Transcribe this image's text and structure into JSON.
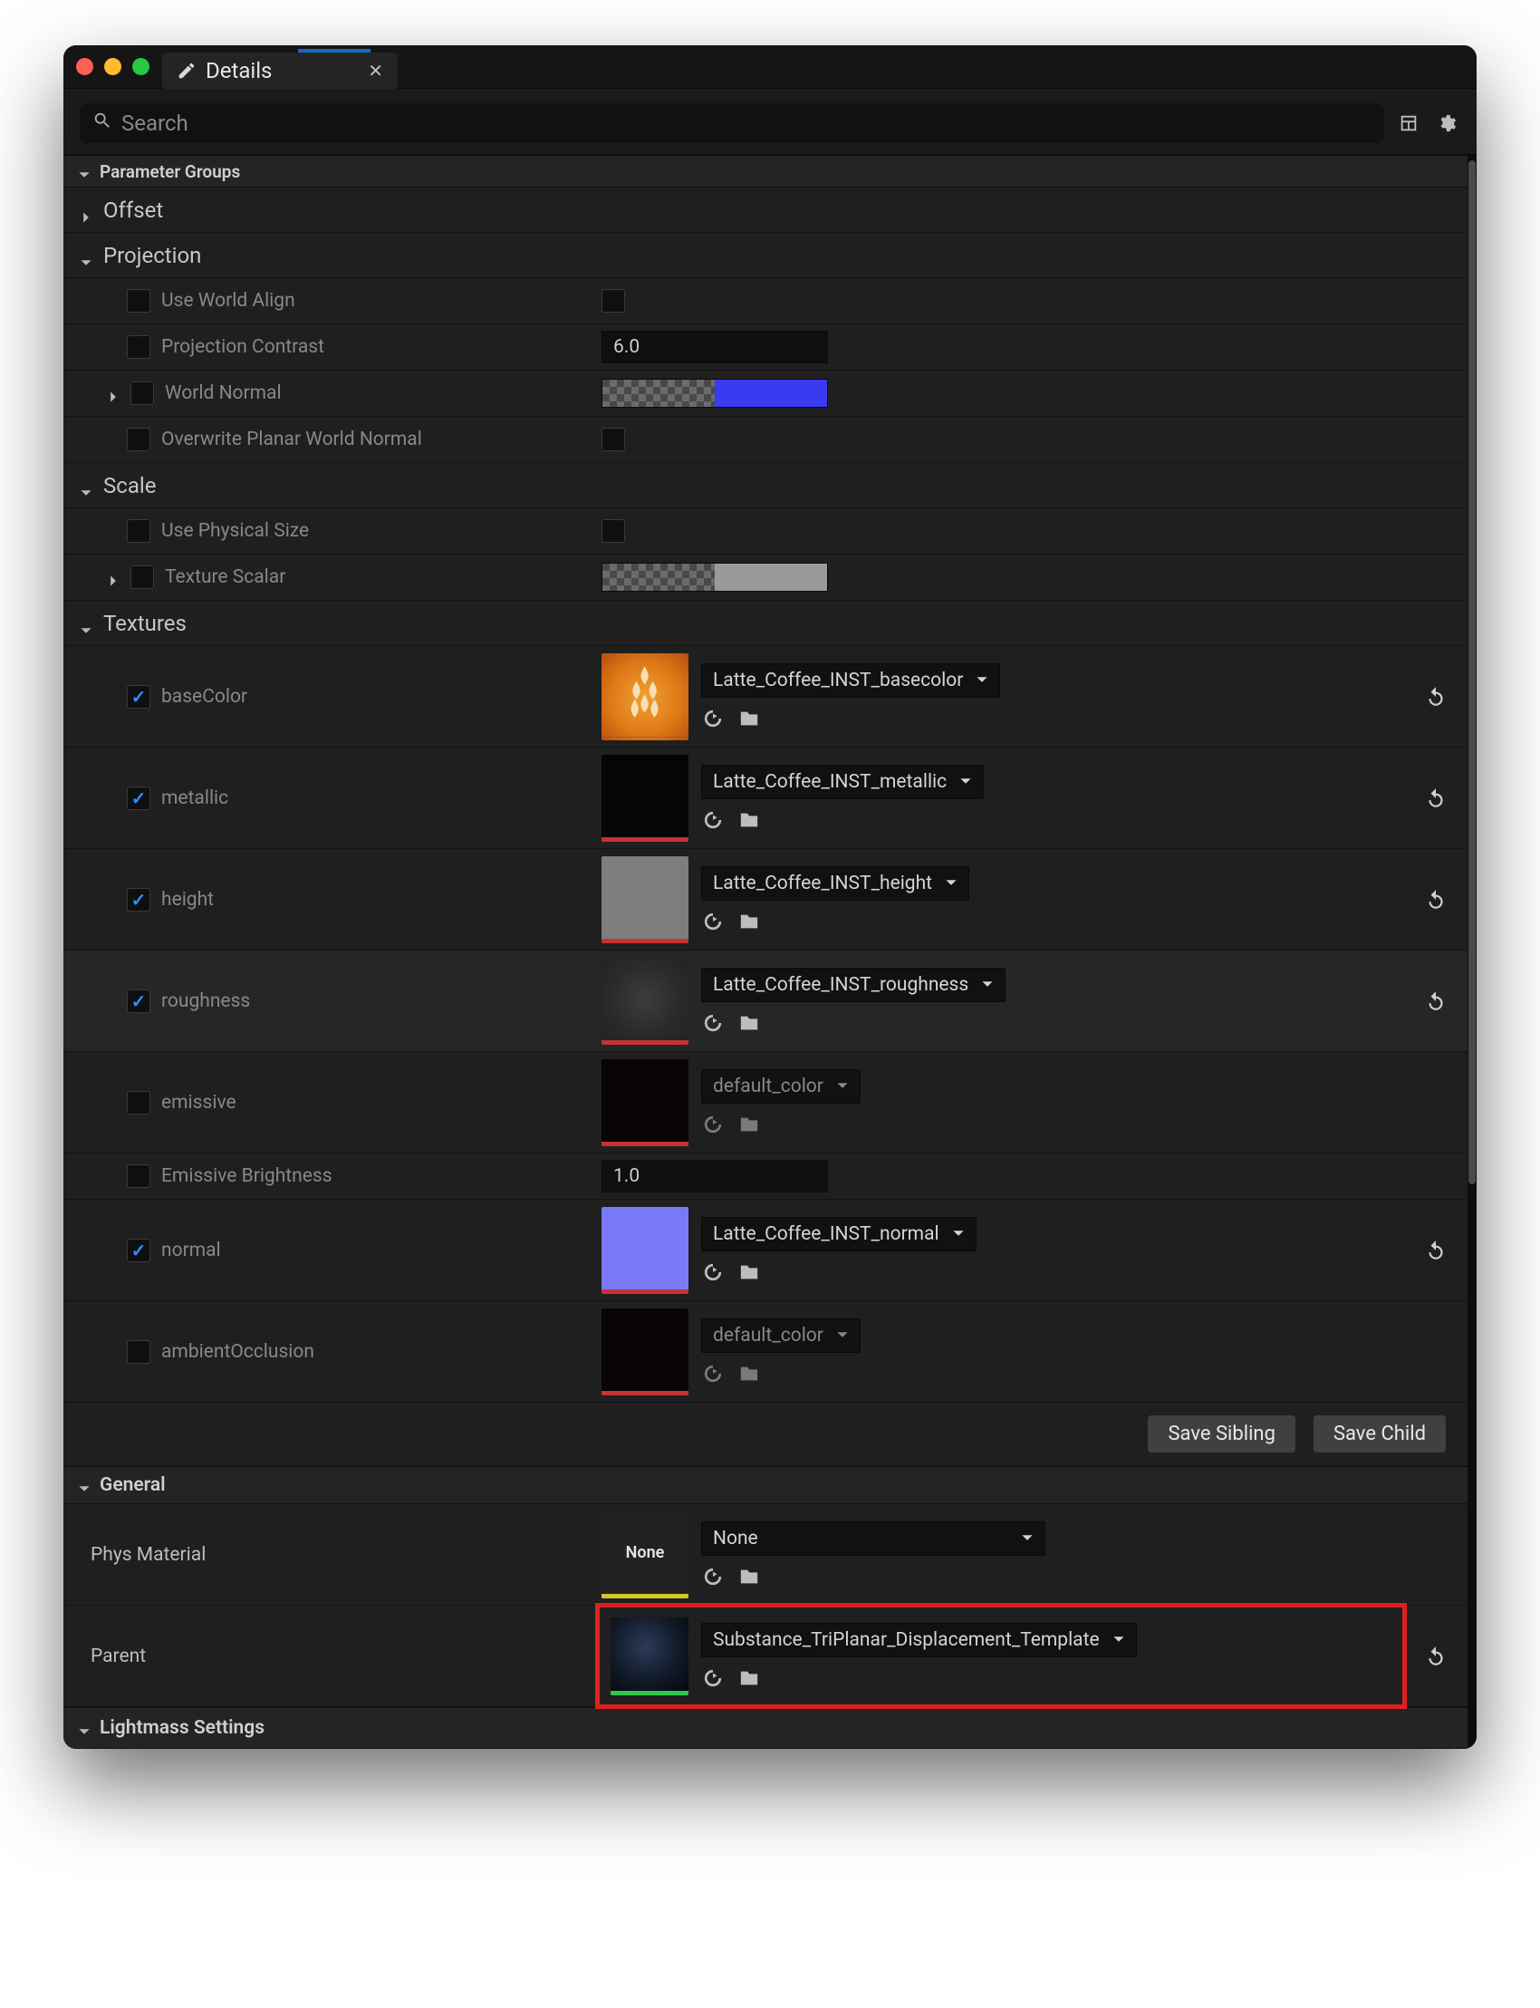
{
  "tab": {
    "title": "Details"
  },
  "search": {
    "placeholder": "Search"
  },
  "sections": {
    "paramGroups": "Parameter Groups",
    "general": "General",
    "lightmass": "Lightmass Settings"
  },
  "groups": {
    "offset": "Offset",
    "projection": "Projection",
    "scale": "Scale",
    "textures": "Textures"
  },
  "projection": {
    "useWorldAlign": "Use World Align",
    "projectionContrast": "Projection Contrast",
    "projectionContrastValue": "6.0",
    "worldNormal": "World Normal",
    "overwritePlanar": "Overwrite Planar World Normal"
  },
  "scale": {
    "usePhysical": "Use Physical Size",
    "textureScalar": "Texture Scalar"
  },
  "textures": {
    "baseColor": {
      "label": "baseColor",
      "asset": "Latte_Coffee_INST_basecolor"
    },
    "metallic": {
      "label": "metallic",
      "asset": "Latte_Coffee_INST_metallic"
    },
    "height": {
      "label": "height",
      "asset": "Latte_Coffee_INST_height"
    },
    "roughness": {
      "label": "roughness",
      "asset": "Latte_Coffee_INST_roughness"
    },
    "emissive": {
      "label": "emissive",
      "asset": "default_color"
    },
    "emissiveBrightness": {
      "label": "Emissive Brightness",
      "value": "1.0"
    },
    "normal": {
      "label": "normal",
      "asset": "Latte_Coffee_INST_normal"
    },
    "ao": {
      "label": "ambientOcclusion",
      "asset": "default_color"
    }
  },
  "buttons": {
    "saveSibling": "Save Sibling",
    "saveChild": "Save Child"
  },
  "general": {
    "physMaterial": {
      "label": "Phys Material",
      "asset": "None",
      "thumbText": "None"
    },
    "parent": {
      "label": "Parent",
      "asset": "Substance_TriPlanar_Displacement_Template"
    }
  }
}
